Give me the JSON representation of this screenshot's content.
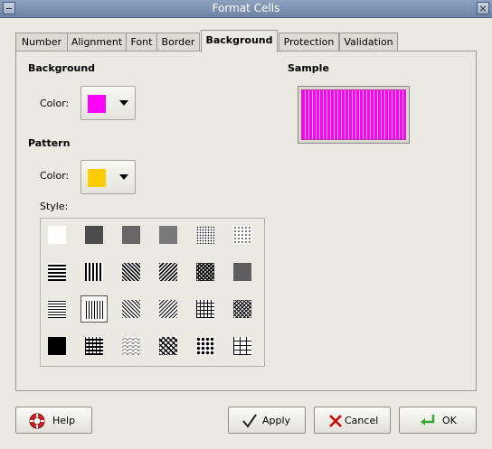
{
  "window": {
    "title": "Format Cells"
  },
  "tabs": [
    {
      "label": "Number"
    },
    {
      "label": "Alignment"
    },
    {
      "label": "Font"
    },
    {
      "label": "Border"
    },
    {
      "label": "Background",
      "active": true
    },
    {
      "label": "Protection"
    },
    {
      "label": "Validation"
    }
  ],
  "background_section": {
    "heading": "Background",
    "color_label": "Color:",
    "color_value": "#ff00ff"
  },
  "pattern_section": {
    "heading": "Pattern",
    "color_label": "Color:",
    "color_value": "#ffcc00",
    "style_label": "Style:",
    "styles": [
      "solid-white",
      "dense-dots-90",
      "dense-dots-75",
      "dots-50",
      "dots-25",
      "dots-12",
      "thick-horizontal",
      "thick-vertical",
      "thick-diagonal-down",
      "thick-diagonal-up",
      "thick-grid",
      "thick-crosshatch",
      "thin-horizontal",
      "thin-vertical",
      "thin-diagonal-down",
      "thin-diagonal-up",
      "thin-grid",
      "thin-crosshatch",
      "solid-black",
      "weave",
      "scales",
      "trellis",
      "circles",
      "bricks"
    ],
    "selected_style": "thin-vertical"
  },
  "sample_section": {
    "heading": "Sample"
  },
  "buttons": {
    "help": "Help",
    "apply": "Apply",
    "cancel": "Cancel",
    "ok": "OK"
  }
}
